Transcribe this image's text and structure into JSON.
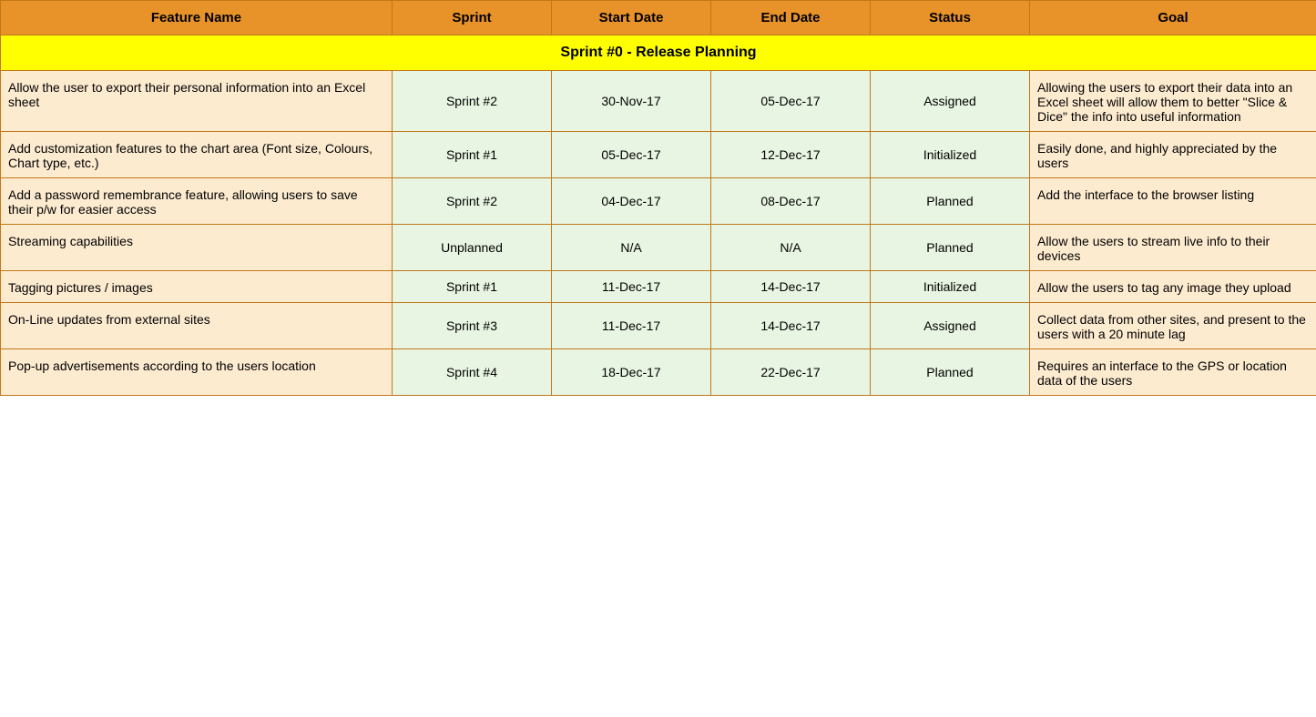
{
  "header": {
    "col_feature": "Feature Name",
    "col_sprint": "Sprint",
    "col_start": "Start Date",
    "col_end": "End Date",
    "col_status": "Status",
    "col_goal": "Goal"
  },
  "sprint_group": {
    "label": "Sprint #0 - Release Planning"
  },
  "rows": [
    {
      "feature": "Allow the user to export their personal information into an Excel sheet",
      "sprint": "Sprint #2",
      "start": "30-Nov-17",
      "end": "05-Dec-17",
      "status": "Assigned",
      "goal": "Allowing the users to export their data into an Excel sheet will allow them to better \"Slice & Dice\" the info into useful information"
    },
    {
      "feature": "Add customization features to the chart area (Font size, Colours, Chart type, etc.)",
      "sprint": "Sprint #1",
      "start": "05-Dec-17",
      "end": "12-Dec-17",
      "status": "Initialized",
      "goal": "Easily done, and highly appreciated by the users"
    },
    {
      "feature": "Add a password remembrance feature, allowing users to save their p/w for easier access",
      "sprint": "Sprint #2",
      "start": "04-Dec-17",
      "end": "08-Dec-17",
      "status": "Planned",
      "goal": "Add the interface to the browser listing"
    },
    {
      "feature": "Streaming capabilities",
      "sprint": "Unplanned",
      "start": "N/A",
      "end": "N/A",
      "status": "Planned",
      "goal": "Allow the users to stream live info to their devices"
    },
    {
      "feature": "Tagging pictures / images",
      "sprint": "Sprint #1",
      "start": "11-Dec-17",
      "end": "14-Dec-17",
      "status": "Initialized",
      "goal": "Allow the users to tag any image they upload"
    },
    {
      "feature": "On-Line updates from external sites",
      "sprint": "Sprint #3",
      "start": "11-Dec-17",
      "end": "14-Dec-17",
      "status": "Assigned",
      "goal": "Collect data from other sites, and present to the users with a 20 minute lag"
    },
    {
      "feature": "Pop-up advertisements according to the users location",
      "sprint": "Sprint #4",
      "start": "18-Dec-17",
      "end": "22-Dec-17",
      "status": "Planned",
      "goal": "Requires an interface to the GPS or location data of the users"
    }
  ]
}
